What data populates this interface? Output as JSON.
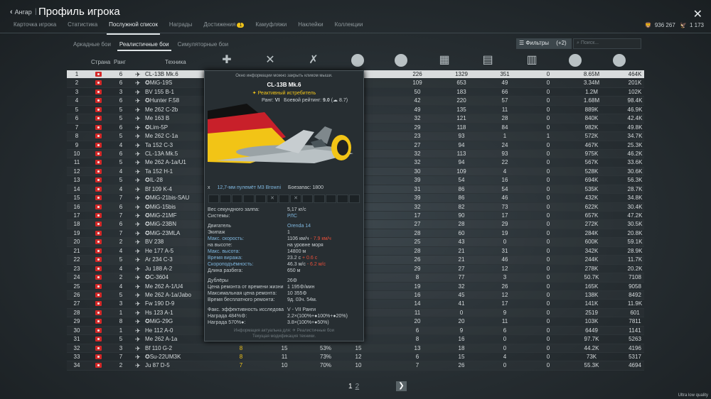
{
  "header": {
    "back_label": "Ангар",
    "separator": "|",
    "title": "Профиль игрока",
    "close": "✕"
  },
  "tabs": [
    {
      "label": "Карточка игрока"
    },
    {
      "label": "Статистика"
    },
    {
      "label": "Послужной список",
      "active": true
    },
    {
      "label": "Награды"
    },
    {
      "label": "Достижения",
      "badge": "1"
    },
    {
      "label": "Камуфляжи"
    },
    {
      "label": "Наклейки"
    },
    {
      "label": "Коллекции"
    }
  ],
  "currency": {
    "silver": "936 267",
    "gold": "1 173"
  },
  "subtabs": [
    {
      "label": "Аркадные бои"
    },
    {
      "label": "Реалистичные бои",
      "active": true
    },
    {
      "label": "Симуляторные бои"
    }
  ],
  "filter": {
    "label": "Фильтры",
    "count": "(+2)"
  },
  "search": {
    "placeholder": "Поиск..."
  },
  "columns": {
    "num": "",
    "country": "Страна",
    "rank": "Ранг",
    "tech": "Техника"
  },
  "rows": [
    {
      "n": "1",
      "r": "6",
      "name": "CL-13B Mk.6",
      "c": [
        "226",
        "1329",
        "351",
        "0",
        "8.65M",
        "464K"
      ]
    },
    {
      "n": "2",
      "r": "6",
      "name": "✪MiG-19S",
      "c": [
        "109",
        "653",
        "49",
        "0",
        "3.34M",
        "201K"
      ]
    },
    {
      "n": "3",
      "r": "3",
      "name": "BV 155 B-1",
      "c": [
        "50",
        "183",
        "66",
        "0",
        "1.2M",
        "102K"
      ]
    },
    {
      "n": "4",
      "r": "6",
      "name": "✪Hunter F.58",
      "c": [
        "42",
        "220",
        "57",
        "0",
        "1.68M",
        "98.4K"
      ]
    },
    {
      "n": "5",
      "r": "5",
      "name": "Me 262 C-2b",
      "c": [
        "49",
        "135",
        "11",
        "0",
        "889K",
        "46.9K"
      ]
    },
    {
      "n": "6",
      "r": "5",
      "name": "Me 163 B",
      "c": [
        "32",
        "121",
        "28",
        "0",
        "840K",
        "42.4K"
      ]
    },
    {
      "n": "7",
      "r": "6",
      "name": "✪Lim-5P",
      "c": [
        "29",
        "118",
        "84",
        "0",
        "982K",
        "49.8K"
      ]
    },
    {
      "n": "8",
      "r": "5",
      "name": "Me 262 C-1a",
      "c": [
        "23",
        "93",
        "1",
        "1",
        "572K",
        "34.7K"
      ]
    },
    {
      "n": "9",
      "r": "4",
      "name": "Ta 152 C-3",
      "c": [
        "27",
        "94",
        "24",
        "0",
        "467K",
        "25.3K"
      ]
    },
    {
      "n": "10",
      "r": "6",
      "name": "CL-13A Mk.5",
      "c": [
        "32",
        "113",
        "93",
        "0",
        "975K",
        "46.2K"
      ]
    },
    {
      "n": "11",
      "r": "5",
      "name": "Me 262 A-1a/U1",
      "c": [
        "32",
        "94",
        "22",
        "0",
        "567K",
        "33.6K"
      ]
    },
    {
      "n": "12",
      "r": "4",
      "name": "Ta 152 H-1",
      "c": [
        "30",
        "109",
        "4",
        "0",
        "528K",
        "30.6K"
      ]
    },
    {
      "n": "13",
      "r": "5",
      "name": "✪IL-28",
      "c": [
        "39",
        "54",
        "16",
        "0",
        "694K",
        "56.3K"
      ]
    },
    {
      "n": "14",
      "r": "4",
      "name": "Bf 109 K-4",
      "c": [
        "31",
        "86",
        "54",
        "0",
        "535K",
        "28.7K"
      ]
    },
    {
      "n": "15",
      "r": "7",
      "name": "✪MiG-21bis-SAU",
      "c": [
        "39",
        "86",
        "46",
        "0",
        "432K",
        "34.8K"
      ]
    },
    {
      "n": "16",
      "r": "6",
      "name": "✪MiG-15bis",
      "c": [
        "32",
        "82",
        "73",
        "0",
        "622K",
        "30.4K"
      ]
    },
    {
      "n": "17",
      "r": "7",
      "name": "✪MiG-21MF",
      "c": [
        "17",
        "90",
        "17",
        "0",
        "657K",
        "47.2K"
      ]
    },
    {
      "n": "18",
      "r": "6",
      "name": "✪MiG-23BN",
      "c": [
        "27",
        "28",
        "29",
        "0",
        "272K",
        "30.5K"
      ]
    },
    {
      "n": "19",
      "r": "7",
      "name": "✪MiG-23MLA",
      "c": [
        "28",
        "60",
        "19",
        "0",
        "284K",
        "20.8K"
      ]
    },
    {
      "n": "20",
      "r": "2",
      "name": "BV 238",
      "c": [
        "25",
        "43",
        "0",
        "0",
        "600K",
        "59.1K"
      ]
    },
    {
      "n": "21",
      "r": "4",
      "name": "He 177 A-5",
      "c": [
        "28",
        "21",
        "31",
        "0",
        "342K",
        "28.9K"
      ]
    },
    {
      "n": "22",
      "r": "5",
      "name": "Ar 234 C-3",
      "c": [
        "26",
        "21",
        "46",
        "0",
        "244K",
        "11.7K"
      ]
    },
    {
      "n": "23",
      "r": "4",
      "name": "Ju 188 A-2",
      "c": [
        "29",
        "27",
        "12",
        "0",
        "278K",
        "20.2K"
      ]
    },
    {
      "n": "24",
      "r": "2",
      "name": "✪C-3604",
      "c": [
        "8",
        "77",
        "3",
        "0",
        "50.7K",
        "7108"
      ]
    },
    {
      "n": "25",
      "r": "4",
      "name": "Me 262 A-1/U4",
      "c": [
        "19",
        "32",
        "26",
        "0",
        "165K",
        "9058"
      ]
    },
    {
      "n": "26",
      "r": "5",
      "name": "Me 262 A-1a/Jabo",
      "c": [
        "16",
        "45",
        "12",
        "0",
        "138K",
        "8492"
      ]
    },
    {
      "n": "27",
      "r": "3",
      "name": "Fw 190 D-9",
      "c": [
        "14",
        "41",
        "17",
        "0",
        "141K",
        "11.9K"
      ]
    },
    {
      "n": "28",
      "r": "1",
      "name": "Hs 123 A-1",
      "c": [
        "11",
        "0",
        "9",
        "0",
        "2519",
        "601"
      ]
    },
    {
      "n": "29",
      "r": "8",
      "name": "✪MiG-29G",
      "c": [
        "20",
        "20",
        "11",
        "0",
        "103K",
        "7811"
      ]
    },
    {
      "n": "30",
      "r": "1",
      "name": "He 112 A-0",
      "c": [
        "6",
        "9",
        "6",
        "0",
        "6449",
        "1141"
      ]
    },
    {
      "n": "31",
      "r": "5",
      "name": "Me 262 A-1a",
      "c": [
        "8",
        "16",
        "0",
        "0",
        "97.7K",
        "5263"
      ]
    },
    {
      "n": "32",
      "r": "3",
      "name": "Bf 110 G-2",
      "e": [
        "8",
        "15",
        "53%",
        "15"
      ],
      "c": [
        "13",
        "18",
        "0",
        "0",
        "44.2K",
        "4196"
      ]
    },
    {
      "n": "33",
      "r": "7",
      "name": "✪Su-22UM3K",
      "e": [
        "8",
        "11",
        "73%",
        "12"
      ],
      "c": [
        "6",
        "15",
        "4",
        "0",
        "73K",
        "5317"
      ]
    },
    {
      "n": "34",
      "r": "2",
      "name": "Ju 87 D-5",
      "e": [
        "7",
        "10",
        "70%",
        "10"
      ],
      "c": [
        "7",
        "26",
        "0",
        "0",
        "55.3K",
        "4694"
      ]
    }
  ],
  "card": {
    "note": "Окно информации можно закрыть кликом мыши.",
    "name": "CL-13B Mk.6",
    "type": "✦ Реактивный истребитель",
    "rank_label": "Ранг:",
    "rank": "VI",
    "br_label": "Боевой рейтинг:",
    "br": "9.0",
    "br_alt": "(☁ 8.7)",
    "weapon_count": "x",
    "weapon": "12,7-мм пулемёт M3 Browni",
    "ammo_label": "Боезапас:",
    "ammo": "1800",
    "stats": [
      {
        "k": "Вес секундного залпа:",
        "v": "5,17 кг/с"
      },
      {
        "k": "Системы:",
        "v": "РЛС",
        "vb": true
      },
      {
        "gap": true
      },
      {
        "k": "Двигатель",
        "v": "Orenda 14",
        "vb": true
      },
      {
        "k": "Экипаж",
        "v": "1"
      },
      {
        "k": "Макс. скорость:",
        "v": "1106 км/ч",
        "ex": " - 7.9 км/ч",
        "kb": true
      },
      {
        "k": "на высоте:",
        "v": "на уровне моря"
      },
      {
        "k": "Макс. высота:",
        "v": "14800 м",
        "kb": true
      },
      {
        "k": "Время виража:",
        "v": "23.2 с",
        "ex": " + 0.6 с",
        "kb": true
      },
      {
        "k": "Скороподъёмность:",
        "v": "46.3 м/с",
        "ex": " - 6.2 м/с",
        "kb": true
      },
      {
        "k": "Длина разбега:",
        "v": "650 м"
      },
      {
        "gap": true
      },
      {
        "k": "Дублёры",
        "v": "26⚙"
      },
      {
        "k": "Цена ремонта от времени жизни",
        "v": "1 195⚙/мин"
      },
      {
        "k": "Максимальная цена ремонта:",
        "v": "10 355⚙"
      },
      {
        "k": "Время бесплатного ремонта:",
        "v": "9д. 03ч. 54м."
      },
      {
        "gap": true
      },
      {
        "k": "Факс. эффективность исследова",
        "v": "V - VII Ранги"
      },
      {
        "k": "Награда 484%⚙:",
        "v": "2.2×(100%+●100%+●20%)"
      },
      {
        "k": "Награда 570%●:",
        "v": "3.8×(100%+●50%)"
      }
    ],
    "footer1": "Информация актуальна для: ✈ Реалистичные бои",
    "footer2": "Текущая модификация техники."
  },
  "pager": {
    "current": "1",
    "next": "2",
    "arrow": "❯"
  },
  "quality": "Ultra low quality"
}
